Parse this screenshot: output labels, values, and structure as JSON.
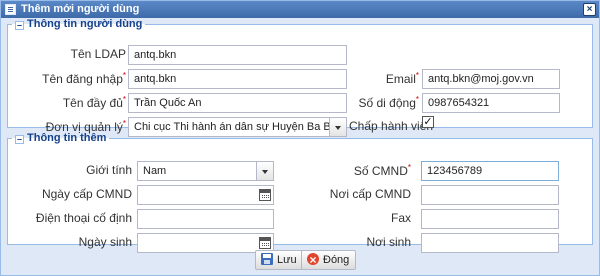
{
  "window": {
    "title": "Thêm mới người dùng"
  },
  "section_user": {
    "legend": "Thông tin người dùng",
    "toggle": "–",
    "ldap_label": "Tên LDAP",
    "ldap_value": "antq.bkn",
    "login_label": "Tên đăng nhập",
    "login_value": "antq.bkn",
    "email_label": "Email",
    "email_value": "antq.bkn@moj.gov.vn",
    "fullname_label": "Tên đầy đủ",
    "fullname_value": "Trần Quốc An",
    "phone_label": "Số di động",
    "phone_value": "0987654321",
    "unit_label": "Đơn vị quản lý",
    "unit_value": "Chi cục Thi hành án dân sự Huyện Ba Bể",
    "executive_label": "Chấp hành viên",
    "executive_checked": "✓",
    "required_mark": "*"
  },
  "section_extra": {
    "legend": "Thông tin thêm",
    "toggle": "–",
    "gender_label": "Giới tính",
    "gender_value": "Nam",
    "id_label": "Số CMND",
    "id_value": "123456789",
    "id_date_label": "Ngày cấp CMND",
    "id_date_value": "",
    "id_place_label": "Nơi cấp CMND",
    "id_place_value": "",
    "landline_label": "Điện thoại cố định",
    "landline_value": "",
    "fax_label": "Fax",
    "fax_value": "",
    "birthday_label": "Ngày sinh",
    "birthday_value": "",
    "birthplace_label": "Nơi sinh",
    "birthplace_value": "",
    "required_mark": "*"
  },
  "buttons": {
    "save_label": "Lưu",
    "close_label": "Đóng"
  },
  "icons": {
    "app": "form-icon",
    "close": "close-icon",
    "save": "save-icon",
    "cancel": "cancel-icon",
    "calendar": "calendar-icon",
    "dropdown": "chevron-down-icon"
  },
  "colors": {
    "title_bar": "#3d6aa8",
    "panel_bg": "#dfe8f6",
    "border": "#99bbe8",
    "legend_text": "#15428b",
    "required": "#cc0000"
  }
}
